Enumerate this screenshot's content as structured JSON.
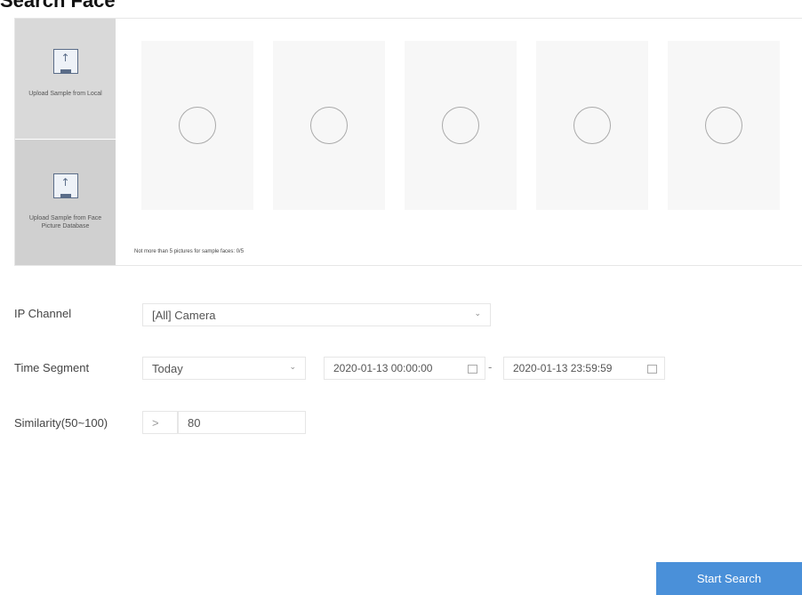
{
  "header": {
    "title": "Search Face"
  },
  "samples": {
    "upload_local_label": "Upload Sample from Local",
    "upload_db_label": "Upload Sample from Face Picture Database",
    "slot_count": 5,
    "note": "Not more than 5 pictures for sample faces: 0/5"
  },
  "form": {
    "ip_channel": {
      "label": "IP Channel",
      "value": "[All] Camera"
    },
    "time_segment": {
      "label": "Time Segment",
      "value": "Today",
      "start": "2020-01-13 00:00:00",
      "separator": "-",
      "end": "2020-01-13 23:59:59"
    },
    "similarity": {
      "label": "Similarity(50~100)",
      "operator": ">",
      "value": "80"
    }
  },
  "actions": {
    "start_search_label": "Start Search"
  },
  "colors": {
    "accent": "#4a90d9",
    "panel_gray": "#d6d6d6"
  },
  "icons": {
    "dropdown": "chevron-down-icon",
    "calendar": "calendar-icon",
    "upload": "upload-icon"
  }
}
